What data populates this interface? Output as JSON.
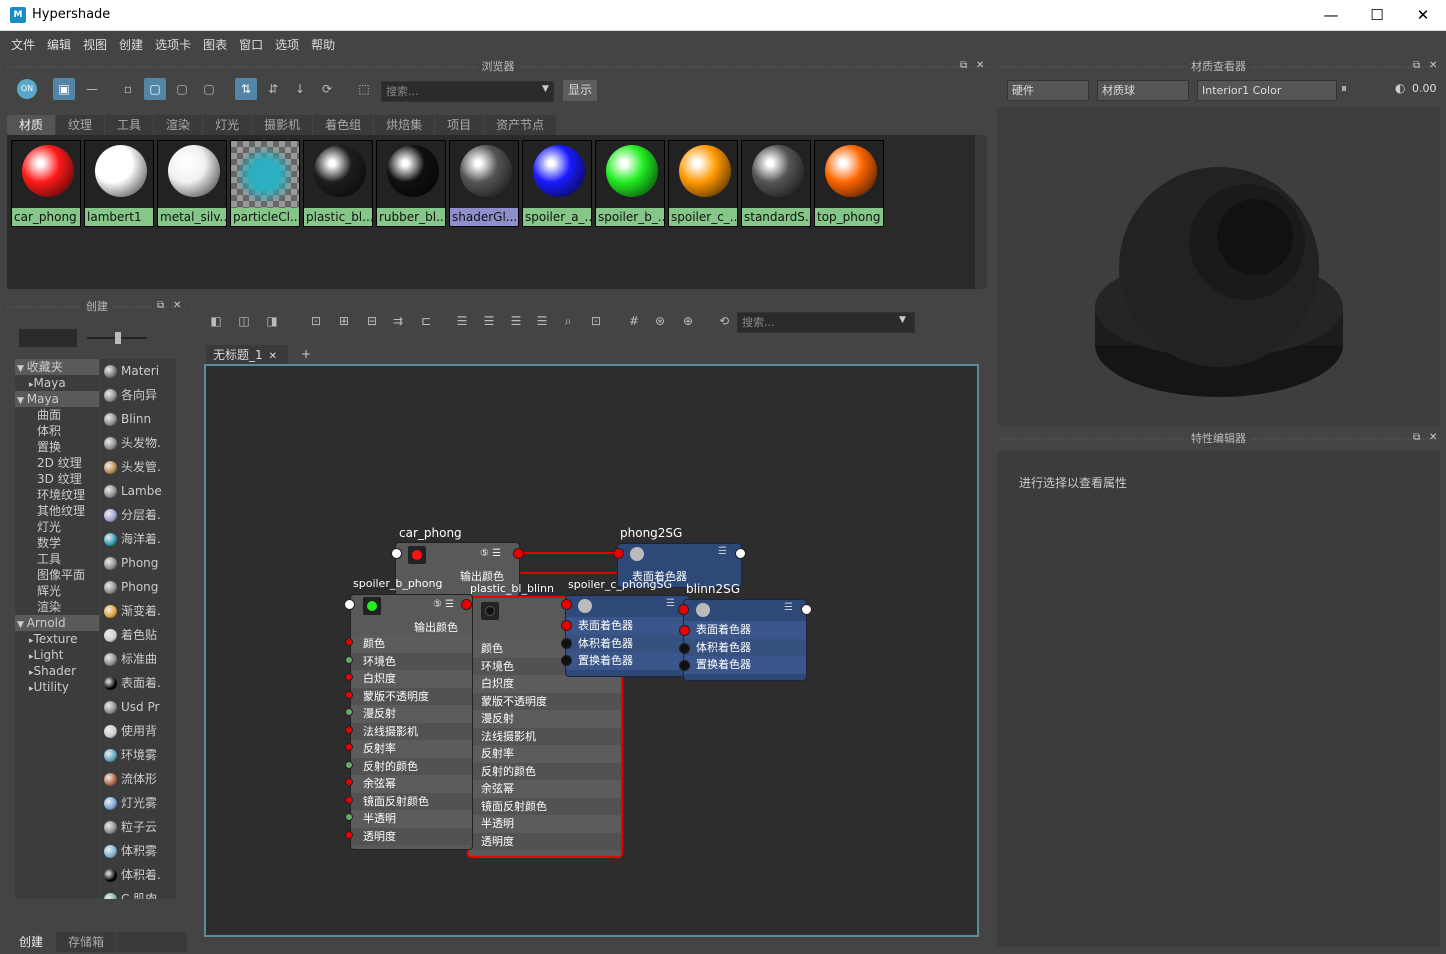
{
  "window": {
    "title": "Hypershade",
    "logo": "M",
    "min": "—",
    "max": "☐",
    "close": "✕"
  },
  "menu": [
    "文件",
    "编辑",
    "视图",
    "创建",
    "选项卡",
    "图表",
    "窗口",
    "选项",
    "帮助"
  ],
  "browser": {
    "title": "浏览器",
    "search_placeholder": "搜索...",
    "show_button": "显示",
    "tabs": [
      "材质",
      "纹理",
      "工具",
      "渲染",
      "灯光",
      "摄影机",
      "着色组",
      "烘焙集",
      "项目",
      "资产节点"
    ],
    "swatches": [
      {
        "label": "car_phong",
        "color": "#ff1a1a"
      },
      {
        "label": "lambert1",
        "color": "#ffffff"
      },
      {
        "label": "metal_silv...",
        "color": "#f0f0f0"
      },
      {
        "label": "particleCl...",
        "color": "#2ab0c0"
      },
      {
        "label": "plastic_bl...",
        "color": "#1e1e1e"
      },
      {
        "label": "rubber_bl...",
        "color": "#101010"
      },
      {
        "label": "shaderGl...",
        "color": "#555555"
      },
      {
        "label": "spoiler_a_...",
        "color": "#1a1aff"
      },
      {
        "label": "spoiler_b_...",
        "color": "#22ee22"
      },
      {
        "label": "spoiler_c_...",
        "color": "#ff9900"
      },
      {
        "label": "standardS...",
        "color": "#555555"
      },
      {
        "label": "top_phong",
        "color": "#ff6600"
      }
    ]
  },
  "create": {
    "title": "创建",
    "tree": [
      "收藏夹",
      "Maya",
      "Maya",
      "曲面",
      "体积",
      "置换",
      "2D 纹理",
      "3D 纹理",
      "环境纹理",
      "其他纹理",
      "灯光",
      "数学",
      "工具",
      "图像平面",
      "辉光",
      "渲染",
      "Arnold",
      "Texture",
      "Light",
      "Shader",
      "Utility"
    ],
    "library": [
      "Materi",
      "各向异",
      "Blinn",
      "头发物.",
      "头发管.",
      "Lambe",
      "分层着.",
      "海洋着.",
      "Phong",
      "Phong",
      "渐变着.",
      "着色贴",
      "标准曲",
      "表面着.",
      "Usd Pr",
      "使用背",
      "环境雾",
      "流体形",
      "灯光雾",
      "粒子云",
      "体积雾",
      "体积着.",
      "C 肌肉."
    ],
    "bottom_tabs": [
      "创建",
      "存储箱"
    ]
  },
  "graph": {
    "tab": "无标题_1",
    "tab_close": "✕",
    "tab_add": "+",
    "search_placeholder": "搜索...",
    "nodes": {
      "car_phong": "car_phong",
      "car_out": "输出颜色",
      "phong2sg": "phong2SG",
      "sg_surface": "表面着色器",
      "spoiler": "spoiler_b_phong",
      "spoiler_out": "输出颜色",
      "plastic": "plastic_bl_blinn",
      "blinn2sg": "blinn2SG",
      "spoilsg": "spoiler_c_phongSG",
      "attrs": [
        "颜色",
        "环境色",
        "白炽度",
        "凹凸贴图",
        "漫反射",
        "法线摄影机",
        "反射率",
        "反射的颜色",
        "余弦幂",
        "镜面反射颜色",
        "半透明",
        "透明度"
      ],
      "attrs2": [
        "颜色",
        "环境色",
        "白炽度",
        "蒙版不透明度",
        "漫反射",
        "法线摄影机",
        "反射率",
        "反射的颜色",
        "余弦幂",
        "镜面反射颜色",
        "半透明",
        "透明度"
      ],
      "sg_attrs": [
        "表面着色器",
        "体积着色器",
        "置换着色器"
      ]
    }
  },
  "viewer": {
    "title": "材质查看器",
    "renderer": "硬件",
    "geometry": "材质球",
    "material": "Interior1 Color",
    "exposure": "0.00"
  },
  "attr_editor": {
    "title": "特性编辑器",
    "hint": "进行选择以查看属性"
  }
}
